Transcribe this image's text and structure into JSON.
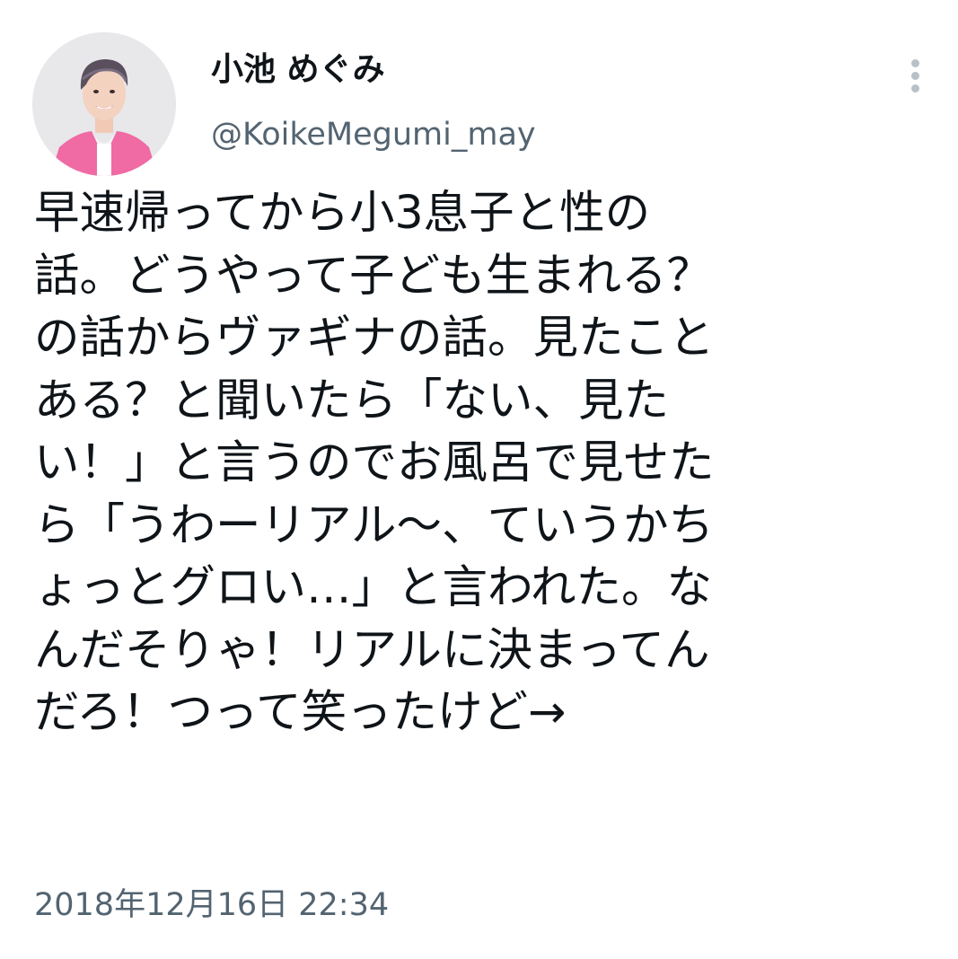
{
  "tweet": {
    "author": {
      "display_name": "小池 めぐみ",
      "handle": "@KoikeMegumi_may",
      "avatar_icon": "profile-photo"
    },
    "more_icon": "more-vertical-icon",
    "text_lines": [
      "早速帰ってから小3息子と性の",
      "話。どうやって子ども生まれる？",
      "の話からヴァギナの話。見たこと",
      "ある？と聞いたら「ない、見た",
      "い！」と言うのでお風呂で見せた",
      "ら「うわーリアル〜、ていうかち",
      "ょっとグロい…」と言われた。な",
      "んだそりゃ！リアルに決まってん",
      "だろ！つって笑ったけど→"
    ],
    "timestamp": "2018年12月16日 22:34"
  },
  "colors": {
    "primary_text": "#0f1419",
    "secondary_text": "#536471",
    "background": "#ffffff",
    "avatar_jacket": "#f06aa3"
  }
}
